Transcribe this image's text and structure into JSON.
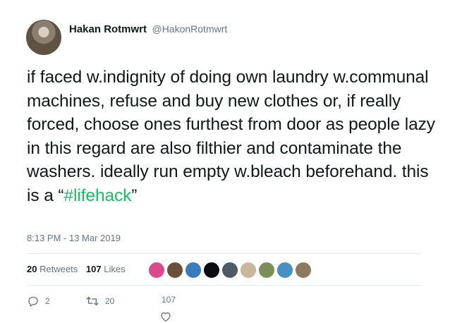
{
  "user": {
    "display_name": "Hakan Rotmwrt",
    "handle": "@HakonRotmwrt",
    "avatar_icon": "profile-photo"
  },
  "tweet": {
    "text_before": "if faced w.indignity of doing own laundry w.communal machines, refuse and buy new clothes or, if really forced, choose ones furthest from door as people lazy in this regard are also filthier and contaminate the washers. ideally run empty w.bleach beforehand. this is a “",
    "hashtag": "#lifehack",
    "text_after": "”",
    "timestamp": "8:13 PM - 13 Mar 2019"
  },
  "stats": {
    "retweets_count": "20",
    "retweets_label": "Retweets",
    "likes_count": "107",
    "likes_label": "Likes"
  },
  "likers": [
    {
      "color": "#d94a8c",
      "icon": "liker-avatar"
    },
    {
      "color": "#6b4f3a",
      "icon": "liker-avatar"
    },
    {
      "color": "#3a7bbf",
      "icon": "liker-avatar"
    },
    {
      "color": "#0b0b12",
      "icon": "liker-avatar"
    },
    {
      "color": "#4f5a66",
      "icon": "liker-avatar"
    },
    {
      "color": "#c9b79c",
      "icon": "liker-avatar"
    },
    {
      "color": "#7c8f5a",
      "icon": "liker-avatar"
    },
    {
      "color": "#4a8fc2",
      "icon": "liker-avatar"
    },
    {
      "color": "#8a7a5e",
      "icon": "liker-avatar"
    }
  ],
  "actions": {
    "reply_count": "2",
    "retweet_count": "20",
    "like_count": "107"
  },
  "colors": {
    "hashtag": "#17bf63",
    "muted": "#657786",
    "text": "#14171a"
  }
}
